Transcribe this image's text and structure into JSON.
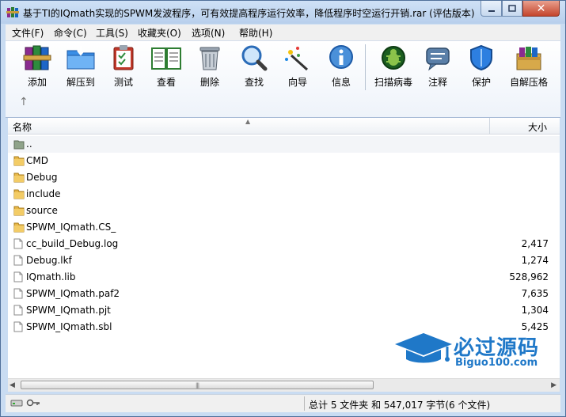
{
  "window": {
    "title": "基于TI的IQmath实现的SPWM发波程序，可有效提高程序运行效率，降低程序时空运行开销.rar (评估版本)"
  },
  "menu": [
    {
      "label": "文件(F)"
    },
    {
      "label": "命令(C)"
    },
    {
      "label": "工具(S)"
    },
    {
      "label": "收藏夹(O)"
    },
    {
      "label": "选项(N)"
    },
    {
      "label": "帮助(H)"
    }
  ],
  "toolbar": [
    {
      "label": "添加",
      "icon": "books-add-icon"
    },
    {
      "label": "解压到",
      "icon": "folder-extract-icon"
    },
    {
      "label": "测试",
      "icon": "clipboard-test-icon"
    },
    {
      "label": "查看",
      "icon": "book-view-icon"
    },
    {
      "label": "删除",
      "icon": "trash-icon"
    },
    {
      "label": "查找",
      "icon": "magnifier-icon"
    },
    {
      "label": "向导",
      "icon": "wand-icon"
    },
    {
      "label": "信息",
      "icon": "info-icon"
    },
    {
      "label": "扫描病毒",
      "icon": "virus-scan-icon"
    },
    {
      "label": "注释",
      "icon": "comment-icon"
    },
    {
      "label": "保护",
      "icon": "shield-icon"
    },
    {
      "label": "自解压格",
      "icon": "sfx-box-icon"
    }
  ],
  "columns": {
    "name": "名称",
    "size": "大小"
  },
  "files": [
    {
      "name": "..",
      "size": "",
      "type": "parent-folder"
    },
    {
      "name": "CMD",
      "size": "",
      "type": "folder"
    },
    {
      "name": "Debug",
      "size": "",
      "type": "folder"
    },
    {
      "name": "include",
      "size": "",
      "type": "folder"
    },
    {
      "name": "source",
      "size": "",
      "type": "folder"
    },
    {
      "name": "SPWM_IQmath.CS_",
      "size": "",
      "type": "folder"
    },
    {
      "name": "cc_build_Debug.log",
      "size": "2,417",
      "type": "file"
    },
    {
      "name": "Debug.lkf",
      "size": "1,274",
      "type": "file"
    },
    {
      "name": "IQmath.lib",
      "size": "528,962",
      "type": "file"
    },
    {
      "name": "SPWM_IQmath.paf2",
      "size": "7,635",
      "type": "file"
    },
    {
      "name": "SPWM_IQmath.pjt",
      "size": "1,304",
      "type": "file"
    },
    {
      "name": "SPWM_IQmath.sbl",
      "size": "5,425",
      "type": "file"
    }
  ],
  "status": {
    "summary": "总计 5 文件夹 和 547,017 字节(6 个文件)"
  },
  "watermark": {
    "text": "必过源码",
    "url": "Biguo100.com"
  },
  "colors": {
    "folder": "#e8b84a",
    "accent": "#1f78c8"
  }
}
